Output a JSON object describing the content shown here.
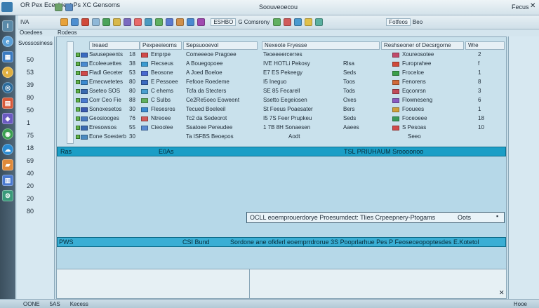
{
  "window": {
    "menu_left": "OR  Pex Ececbiest  Ps  XC Gensoms",
    "label_left2": "IVA",
    "title": "Soouveoecou",
    "right_label": "Fecus",
    "tab_a": "Ooedees",
    "tab_b": "Rodeos",
    "toolbar_center": "ESHBO",
    "toolbar_center2": "G Comsrony",
    "toolbar_right": "Fotfeos",
    "toolbar_right2": "Beo"
  },
  "left_panel": {
    "header": "Svossosiness",
    "numbers": [
      "50",
      "53",
      "39",
      "80",
      "50",
      "1",
      "75",
      "18",
      "69",
      "40",
      "20",
      "20",
      "80"
    ]
  },
  "table": {
    "columns": [
      "Ireaed",
      "Pexpeeieorns",
      "Sepsuooevol",
      "Nexeote Fryesse",
      "Reshseoner of Decsrgorne",
      "Wre"
    ],
    "rows": [
      {
        "name": "Swusepeents",
        "mark": "18",
        "c2": "Emprpe",
        "c3": "Comeeeoe Pragoee",
        "c4": "Teoeeeercerres",
        "c5": "",
        "c6": "Xoureosotee",
        "c7": "2"
      },
      {
        "name": "Ecoleeuettes",
        "mark": "38",
        "c2": "Flecseus",
        "c3": "A Bouegopoee",
        "c4": "IVE HOTLi Pekosy",
        "c5": "Rlsa",
        "c6": "Furoprahee",
        "c7": "f"
      },
      {
        "name": "Fladl Geceter",
        "mark": "53",
        "c2": "Beosone",
        "c3": "A Joed Boeloe",
        "c4": "E7 ES Pekeegy",
        "c5": "Seds",
        "c6": "Froceloe",
        "c7": "1"
      },
      {
        "name": "Emecwetetes",
        "mark": "80",
        "c2": "E Pessoee",
        "c3": "Fefooe Roedeme",
        "c4": "I5 Ineguo",
        "c5": "Toos",
        "c6": "Fenorens",
        "c7": "8"
      },
      {
        "name": "Sseteo SOS",
        "mark": "80",
        "c2": "C ehems",
        "c3": "Tcfa da Stecters",
        "c4": "SE 85 Fecarell",
        "c5": "Tods",
        "c6": "Eqconrsn",
        "c7": "3"
      },
      {
        "name": "Corr Ceo Fie",
        "mark": "88",
        "c2": "C Sulbs",
        "c3": "Ce2Re5oeo Eoweent",
        "c4": "Ssetto Eegeiosen",
        "c5": "Oxes",
        "c6": "Flowneseng",
        "c7": "6"
      },
      {
        "name": "Sonoxesetos",
        "mark": "30",
        "c2": "Flesesros",
        "c3": "Tecued Boeleeil",
        "c4": "St Feeus Poaesater",
        "c5": "Bers",
        "c6": "Foouees",
        "c7": "1"
      },
      {
        "name": "Geosiooges",
        "mark": "76",
        "c2": "Ntreoee",
        "c3": "Tc2 da Sedeorot",
        "c4": "I5 7S Feer Prupkeu",
        "c5": "Seds",
        "c6": "Foceoeee",
        "c7": "18"
      },
      {
        "name": "Eresowsos",
        "mark": "55",
        "c2": "Cieoolee",
        "c3": "Ssatoee Pereudee",
        "c4": "1 7B 8H Sonaesen",
        "c5": "Aaees",
        "c6": "S Pesoas",
        "c7": "10"
      },
      {
        "name": "Eone Soesterb",
        "mark": "30",
        "c2": "",
        "c3": "Ta ISFBS Beoepos",
        "c4": "Aodt",
        "c5": "",
        "c6": "Seeo",
        "c7": ""
      }
    ]
  },
  "band1": {
    "left": "Ras",
    "center": "E0As",
    "right": "TSL PRIUHAUM Sroooonoo"
  },
  "field1": {
    "text": "OCLL eoemprouerdorye Proesumdect: Tlies Crpeepnery-Ptogams",
    "right": "Oots"
  },
  "band2": {
    "left": "PWS",
    "center": "CSI Bund",
    "right": "Sordone ane ofkferl eoemprrdrorue 3S Pooprlarhue Pes P Feoseceopoptesdes E.Kotetol"
  },
  "statusbar": {
    "left": "OONE",
    "item2": "5AS",
    "item3": "Kecess",
    "right": "Hooe"
  },
  "accent_color": "#1b9ec6"
}
